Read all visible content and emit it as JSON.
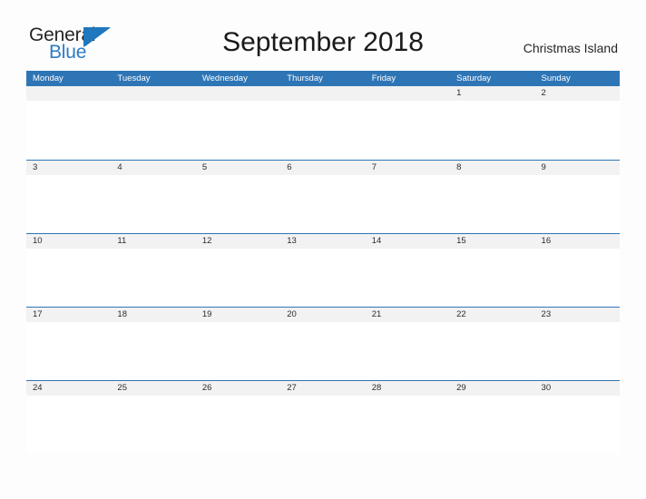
{
  "brand": {
    "name_part1": "General",
    "name_part2": "Blue",
    "flag_icon": "blue-flag-triangle",
    "color_primary": "#2b7cc4",
    "color_text": "#262626"
  },
  "header": {
    "title": "September 2018",
    "region": "Christmas Island"
  },
  "calendar": {
    "header_bg": "#2e75b6",
    "band_bg": "#f2f2f2",
    "rule_color": "#2e75b6",
    "weekdays": [
      "Monday",
      "Tuesday",
      "Wednesday",
      "Thursday",
      "Friday",
      "Saturday",
      "Sunday"
    ],
    "weeks": [
      [
        "",
        "",
        "",
        "",
        "",
        "1",
        "2"
      ],
      [
        "3",
        "4",
        "5",
        "6",
        "7",
        "8",
        "9"
      ],
      [
        "10",
        "11",
        "12",
        "13",
        "14",
        "15",
        "16"
      ],
      [
        "17",
        "18",
        "19",
        "20",
        "21",
        "22",
        "23"
      ],
      [
        "24",
        "25",
        "26",
        "27",
        "28",
        "29",
        "30"
      ]
    ]
  }
}
